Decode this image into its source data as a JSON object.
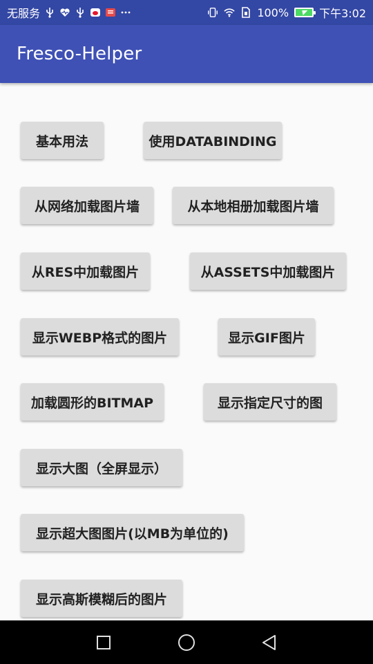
{
  "status_bar": {
    "carrier": "无服务",
    "left_icons": [
      "usb-icon",
      "heart-rate-icon",
      "usb-icon",
      "weibo-icon",
      "news-icon",
      "more-dots-icon"
    ],
    "battery_percent": "100%",
    "time": "下午3:02",
    "right_icons": [
      "vibrate-icon",
      "wifi-icon",
      "sim-icon",
      "battery-charging-icon"
    ]
  },
  "app_bar": {
    "title": "Fresco-Helper"
  },
  "buttons": [
    {
      "label": "基本用法"
    },
    {
      "label": "使用DATABINDING"
    },
    {
      "label": "从网络加载图片墙"
    },
    {
      "label": "从本地相册加载图片墙"
    },
    {
      "label": "从RES中加载图片"
    },
    {
      "label": "从ASSETS中加载图片"
    },
    {
      "label": "显示WEBP格式的图片"
    },
    {
      "label": "显示GIF图片"
    },
    {
      "label": "加载圆形的BITMAP"
    },
    {
      "label": "显示指定尺寸的图"
    },
    {
      "label": "显示大图（全屏显示）"
    },
    {
      "label": "显示超大图图片(以MB为单位的)"
    },
    {
      "label": "显示高斯模糊后的图片"
    }
  ],
  "nav_bar": {
    "items": [
      "recent-apps-icon",
      "home-icon",
      "back-icon"
    ]
  },
  "colors": {
    "status_bar": "#3347a4",
    "app_bar": "#3f51b5",
    "button": "#dcdcdc",
    "background": "#fafafa",
    "nav_bar": "#000000"
  }
}
